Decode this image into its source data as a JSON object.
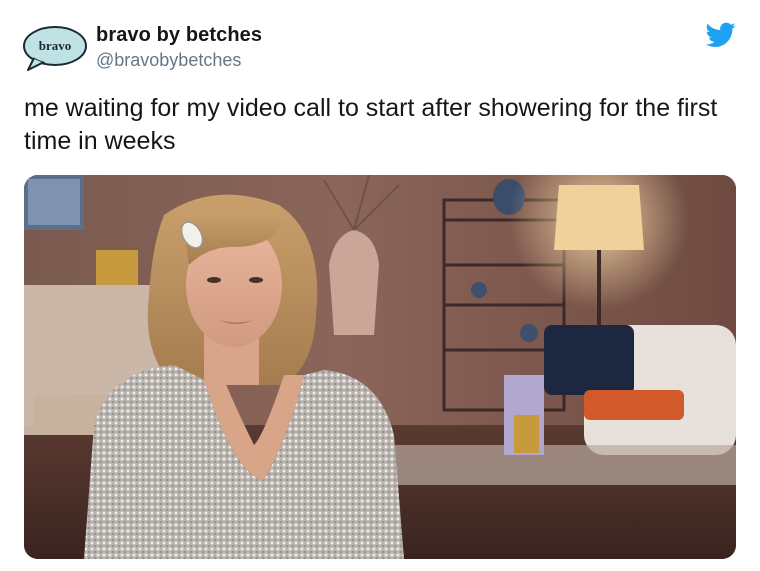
{
  "account": {
    "avatar_text": "bravo",
    "name": "bravo by betches",
    "handle": "@bravobybetches"
  },
  "icons": {
    "platform": "twitter-bird-icon",
    "brand_color": "#1DA1F2"
  },
  "tweet": {
    "text": "me waiting for my video call to start after showering for the first time in weeks"
  },
  "media": {
    "kind": "photo"
  }
}
